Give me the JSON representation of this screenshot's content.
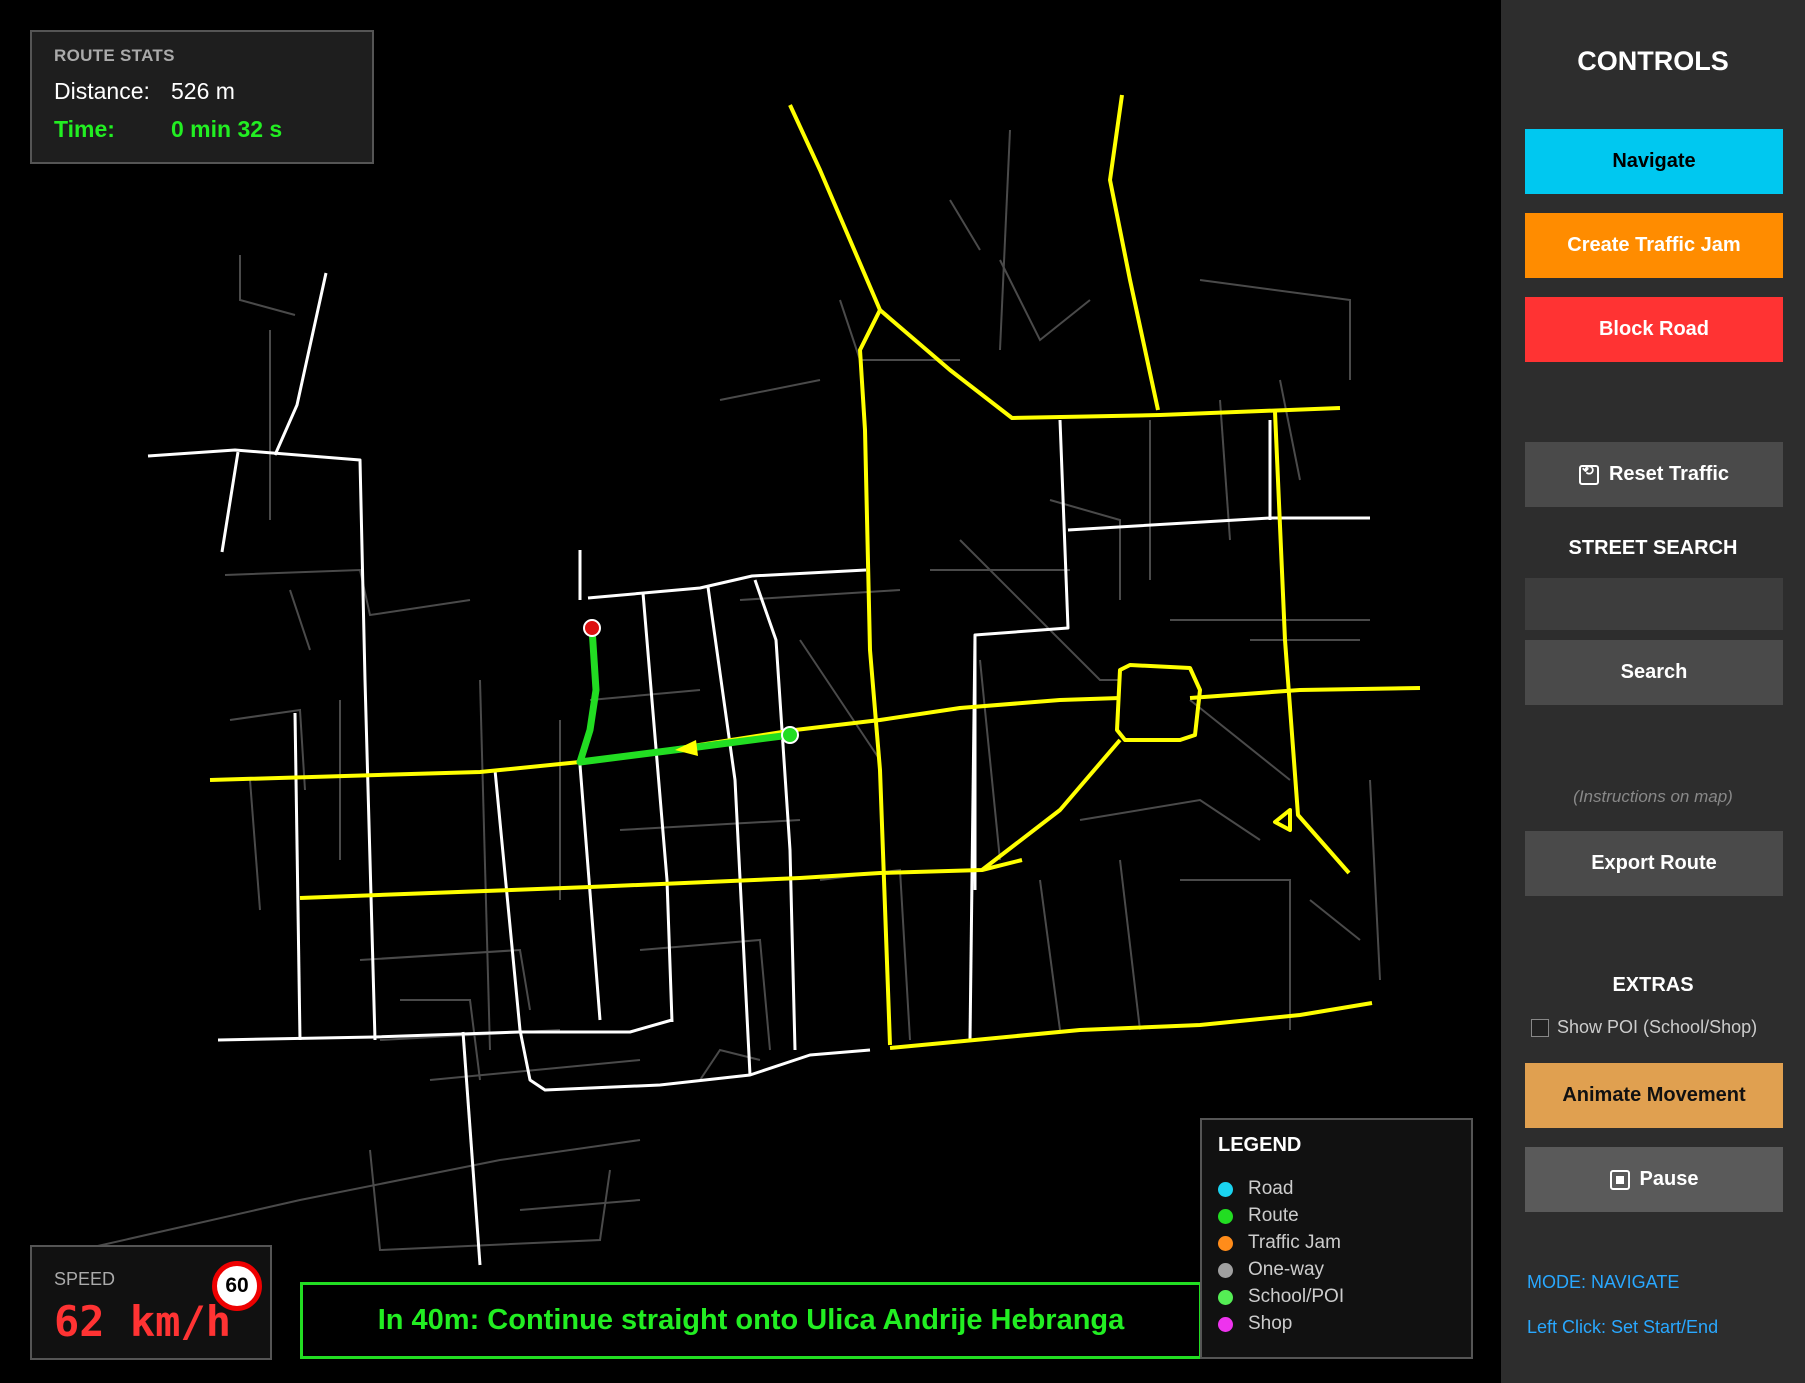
{
  "route_stats": {
    "title": "ROUTE STATS",
    "distance_label": "Distance:",
    "distance_value": "526 m",
    "time_label": "Time:",
    "time_value": "0 min 32 s"
  },
  "speed": {
    "title": "SPEED",
    "value": "62 km/h",
    "limit": "60"
  },
  "instruction": "In 40m: Continue straight onto Ulica Andrije Hebranga",
  "legend": {
    "title": "LEGEND",
    "items": [
      {
        "label": "Road",
        "color": "#1ad3f0"
      },
      {
        "label": "Route",
        "color": "#22dd22"
      },
      {
        "label": "Traffic Jam",
        "color": "#ff8c1a"
      },
      {
        "label": "One-way",
        "color": "#a0a0a0"
      },
      {
        "label": "School/POI",
        "color": "#55ee55"
      },
      {
        "label": "Shop",
        "color": "#ee33ee"
      }
    ]
  },
  "controls": {
    "title": "CONTROLS",
    "navigate": "Navigate",
    "create_jam": "Create Traffic Jam",
    "block_road": "Block Road",
    "reset_traffic": "Reset Traffic",
    "street_search_title": "STREET SEARCH",
    "search_value": "",
    "search_button": "Search",
    "instructions_note": "(Instructions on map)",
    "export_route": "Export Route",
    "extras_title": "EXTRAS",
    "show_poi_label": "Show POI (School/Shop)",
    "show_poi_checked": false,
    "animate": "Animate Movement",
    "pause": "Pause",
    "mode": "MODE: NAVIGATE",
    "hint": "Left Click: Set Start/End"
  },
  "colors": {
    "navigate": "#00c8f0",
    "create_jam": "#ff8c00",
    "block_road": "#ff3333",
    "secondary": "#4a4a4a",
    "animate": "#e0a050",
    "main_road": "#ffff00",
    "road": "#ffffff",
    "minor_road": "#4a4a4a",
    "route": "#22dd22"
  }
}
